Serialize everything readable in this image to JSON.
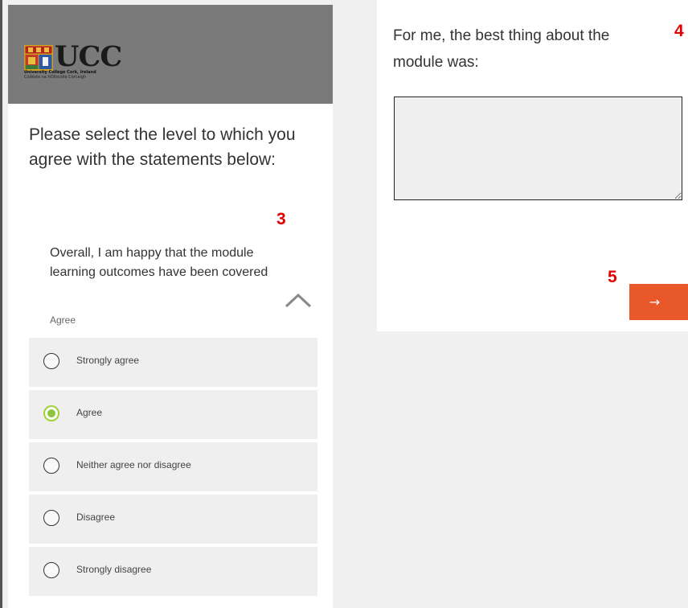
{
  "logo": {
    "brand": "UCC",
    "line1": "University College Cork, Ireland",
    "line2": "Coláiste na hOllscoile Corcaigh"
  },
  "question": {
    "text": "Please select the level to which you agree with the statements below:"
  },
  "annotations": {
    "a3": "3",
    "a4": "4",
    "a5": "5"
  },
  "statement": {
    "text": "Overall, I am happy that the module learning outcomes have been covered",
    "selected_value": "Agree"
  },
  "options": [
    {
      "label": "Strongly agree",
      "checked": false
    },
    {
      "label": "Agree",
      "checked": true
    },
    {
      "label": "Neither agree nor disagree",
      "checked": false
    },
    {
      "label": "Disagree",
      "checked": false
    },
    {
      "label": "Strongly disagree",
      "checked": false
    }
  ],
  "feedback": {
    "question": "For me, the best thing about the module was:",
    "value": ""
  },
  "next_button": {
    "label": "→"
  },
  "colors": {
    "accent_button": "#e8582b",
    "radio_selected": "#8cc63f",
    "annotation": "#e00000",
    "header_bg": "#7a7a7a"
  },
  "icons": {
    "collapse": "chevron-up-icon",
    "logo": "ucc-crest-icon"
  }
}
